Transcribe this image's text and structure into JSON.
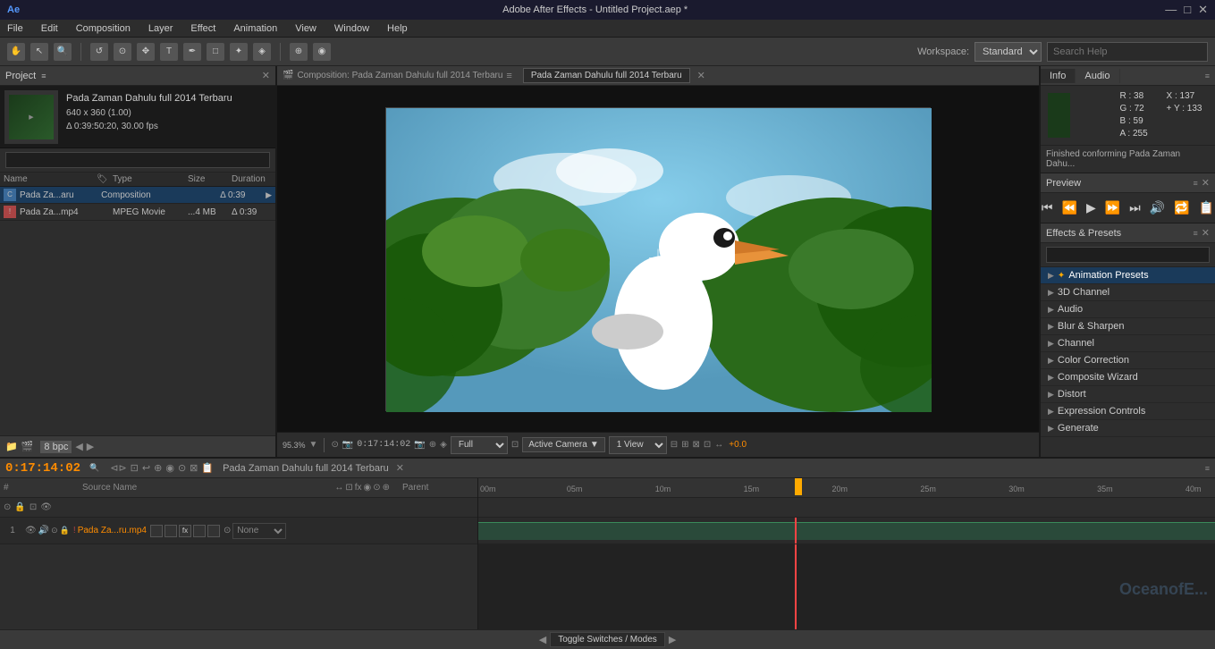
{
  "titlebar": {
    "title": "Adobe After Effects - Untitled Project.aep *",
    "minimize": "—",
    "maximize": "□",
    "close": "✕"
  },
  "menubar": {
    "items": [
      "File",
      "Edit",
      "Composition",
      "Layer",
      "Effect",
      "Animation",
      "View",
      "Window",
      "Help"
    ]
  },
  "toolbar": {
    "workspace_label": "Workspace:",
    "workspace_value": "Standard",
    "search_placeholder": "Search Help",
    "search_value": "Search Help"
  },
  "project": {
    "panel_title": "Project",
    "composition_name": "Pada Zaman Dahulu full 2014 Terbaru",
    "resolution": "640 x 360 (1.00)",
    "duration": "Δ 0:39:50:20, 30.00 fps",
    "files": [
      {
        "name": "Pada Za...aru",
        "icon": "comp",
        "type": "Composition",
        "size": "",
        "duration": "Δ 0:39"
      },
      {
        "name": "Pada Za...mp4",
        "icon": "video",
        "type": "MPEG Movie",
        "size": "...4 MB",
        "duration": "Δ 0:39"
      }
    ],
    "columns": {
      "name": "Name",
      "type": "Type",
      "size": "Size",
      "duration": "Duration"
    },
    "bpc": "8 bpc"
  },
  "composition": {
    "panel_title": "Composition: Pada Zaman Dahulu full 2014 Terbaru",
    "tab_label": "Pada Zaman Dahulu full 2014 Terbaru",
    "zoom": "95.3%",
    "timecode": "0:17:14:02",
    "quality": "Full",
    "view": "Active Camera",
    "view_mode": "1 View",
    "offset": "+0.0"
  },
  "info": {
    "panel_title": "Info",
    "audio_label": "Audio",
    "r": "R : 38",
    "g": "G : 72",
    "b": "B : 59",
    "a": "A : 255",
    "x": "X : 137",
    "y": "+ Y : 133",
    "status_msg": "Finished conforming Pada Zaman Dahu..."
  },
  "preview": {
    "panel_title": "Preview",
    "buttons": [
      "⏮",
      "⏪",
      "▶",
      "⏩",
      "⏭",
      "🔊",
      "📋",
      "🎞"
    ]
  },
  "effects": {
    "panel_title": "Effects & Presets",
    "search_placeholder": "",
    "items": [
      {
        "label": "* Animation Presets",
        "selected": false,
        "starred": true
      },
      {
        "label": "3D Channel",
        "selected": false
      },
      {
        "label": "Audio",
        "selected": false
      },
      {
        "label": "Blur & Sharpen",
        "selected": false
      },
      {
        "label": "Channel",
        "selected": false
      },
      {
        "label": "Color Correction",
        "selected": false
      },
      {
        "label": "Composite Wizard",
        "selected": false
      },
      {
        "label": "Distort",
        "selected": false
      },
      {
        "label": "Expression Controls",
        "selected": false
      },
      {
        "label": "Generate",
        "selected": false
      }
    ]
  },
  "timeline": {
    "panel_title": "Pada Zaman Dahulu full 2014 Terbaru",
    "timecode": "0:17:14:02",
    "marks": [
      "00m",
      "05m",
      "10m",
      "15m",
      "20m",
      "25m",
      "30m",
      "35m",
      "40m"
    ],
    "layers": [
      {
        "num": "1",
        "name": "Pada Za...ru.mp4",
        "parent": "None"
      }
    ],
    "columns": {
      "source": "Source Name",
      "parent": "Parent"
    },
    "toggle_label": "Toggle Switches / Modes"
  },
  "watermark": "OceanofE..."
}
